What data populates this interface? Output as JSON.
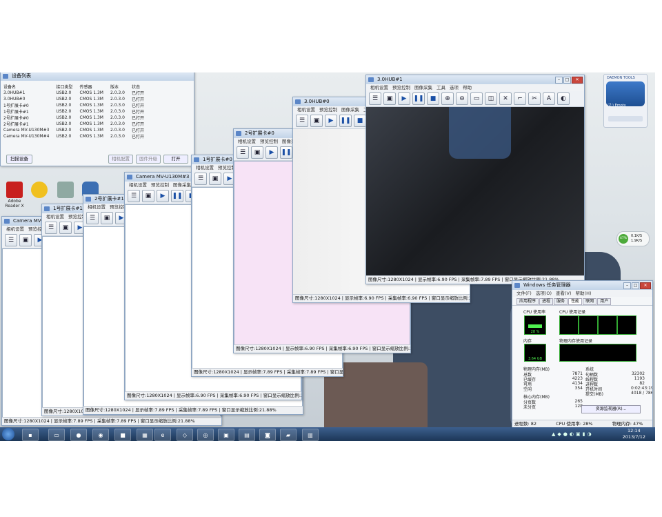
{
  "device_list": {
    "title": "设备列表",
    "columns": [
      "设备名",
      "接口类型",
      "传感器",
      "版本",
      "状态"
    ],
    "rows": [
      [
        "3.0HUB#1",
        "USB2.0",
        "CMOS 1.3M",
        "2.0.3.0",
        "已打开"
      ],
      [
        "3.0HUB#0",
        "USB2.0",
        "CMOS 1.3M",
        "2.0.3.0",
        "已打开"
      ],
      [
        "1号扩展卡#0",
        "USB2.0",
        "CMOS 1.3M",
        "2.0.3.0",
        "已打开"
      ],
      [
        "1号扩展卡#1",
        "USB2.0",
        "CMOS 1.3M",
        "2.0.3.0",
        "已打开"
      ],
      [
        "2号扩展卡#0",
        "USB2.0",
        "CMOS 1.3M",
        "2.0.3.0",
        "已打开"
      ],
      [
        "2号扩展卡#1",
        "USB2.0",
        "CMOS 1.3M",
        "2.0.3.0",
        "已打开"
      ],
      [
        "Camera MV-U130M#3",
        "USB2.0",
        "CMOS 1.3M",
        "2.0.3.0",
        "已打开"
      ],
      [
        "Camera MV-U130M#4",
        "USB2.0",
        "CMOS 1.3M",
        "2.0.3.0",
        "已打开"
      ]
    ],
    "scan_button": "扫描设备",
    "param_button": "相机配置",
    "firmware_button": "固件升级",
    "open_button": "打开"
  },
  "desktop_icons": [
    {
      "label": "Adobe Reader X",
      "color": "#c8201e"
    },
    {
      "label": "腾讯QQ",
      "color": "#f0c020"
    },
    {
      "label": "",
      "color": "#8fa9a2"
    },
    {
      "label": "",
      "color": "#3c6fb3"
    }
  ],
  "camera_windows": [
    {
      "id": "w1",
      "title": "Camera MV-U130M#4",
      "status": "图像尺寸:1280X1024 | 显示帧率:7.89 FPS | 采集帧率:7.89 FPS | 窗口显示缩放比例:21.88%"
    },
    {
      "id": "w2",
      "title": "1号扩展卡#1",
      "status": "图像尺寸:1280X1024 | 显示帧率:7.89 FPS | 采集帧率:7.89 FPS | 窗口显示缩放比例:21.88%"
    },
    {
      "id": "w3",
      "title": "2号扩展卡#1",
      "status": "图像尺寸:1280X1024 | 显示帧率:7.89 FPS | 采集帧率:7.89 FPS | 窗口显示缩放比例:21.88%"
    },
    {
      "id": "w4",
      "title": "Camera MV-U130M#3",
      "status": "图像尺寸:1280X1024 | 显示帧率:6.90 FPS | 采集帧率:6.90 FPS | 窗口显示缩放比例:21.88%"
    },
    {
      "id": "w5",
      "title": "1号扩展卡#0",
      "status": "图像尺寸:1280X1024 | 显示帧率:7.89 FPS | 采集帧率:7.89 FPS | 窗口显示缩放比例:21.88%"
    },
    {
      "id": "w6",
      "title": "2号扩展卡#0",
      "status": "图像尺寸:1280X1024 | 显示帧率:6.90 FPS | 采集帧率:6.90 FPS | 窗口显示缩放比例:21.88%"
    },
    {
      "id": "w7",
      "title": "3.0HUB#0",
      "status": "图像尺寸:1280X1024 | 显示帧率:6.90 FPS | 采集帧率:6.90 FPS | 窗口显示缩放比例:21.88%"
    },
    {
      "id": "w8",
      "title": "3.0HUB#1",
      "status": "图像尺寸:1280X1024 | 显示帧率:6.90 FPS | 采集帧率:7.89 FPS | 窗口显示缩放比例:21.88%"
    }
  ],
  "camera_menu": [
    "相机设置",
    "预览控制",
    "图像采集",
    "工具",
    "选项",
    "帮助"
  ],
  "gadget": {
    "title": "DAEMON TOOLS",
    "drive": "(Z:) Empty"
  },
  "net_gadget": {
    "percent": "47%",
    "up": "0.1K/S",
    "down": "1.9K/S"
  },
  "taskbar": {
    "time": "12:14",
    "date": "2013/7/12"
  },
  "task_manager": {
    "title": "Windows 任务管理器",
    "menu": [
      "文件(F)",
      "选项(O)",
      "查看(V)",
      "帮助(H)"
    ],
    "tabs": [
      "应用程序",
      "进程",
      "服务",
      "性能",
      "联网",
      "用户"
    ],
    "active_tab": "性能",
    "cpu_label": "CPU 使用率",
    "cpu_value": "28 %",
    "cpu_history_label": "CPU 使用记录",
    "mem_label": "内存",
    "mem_value": "3.64 GB",
    "mem_history_label": "物理内存使用记录",
    "phys_title": "物理内存(MB)",
    "phys": [
      [
        "总数",
        "7871"
      ],
      [
        "已缓存",
        "4223"
      ],
      [
        "可用",
        "4134"
      ],
      [
        "空闲",
        "354"
      ]
    ],
    "sys_title": "系统",
    "sys": [
      [
        "句柄数",
        "32302"
      ],
      [
        "线程数",
        "1193"
      ],
      [
        "进程数",
        "82"
      ],
      [
        "开机时间",
        "0:02:43:19"
      ],
      [
        "提交(MB)",
        "4018 / 7868"
      ]
    ],
    "kernel_title": "核心内存(MB)",
    "kernel": [
      [
        "分页数",
        "265"
      ],
      [
        "未分页",
        "128"
      ]
    ],
    "resmon_button": "资源监视器(R)...",
    "status_processes": "进程数: 82",
    "status_cpu": "CPU 使用率: 28%",
    "status_mem": "物理内存: 47%"
  }
}
